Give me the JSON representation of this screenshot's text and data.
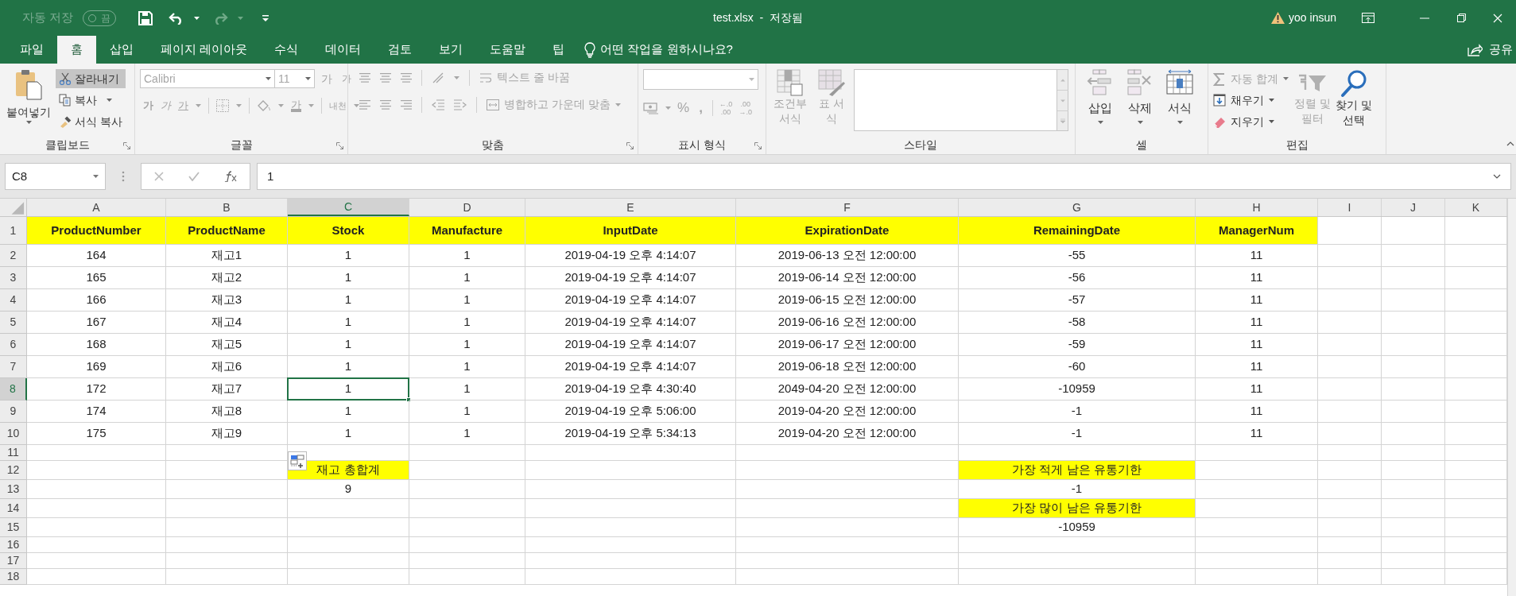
{
  "title_bar": {
    "autosave_label": "자동 저장",
    "autosave_state": "끔",
    "autosave_on": false,
    "title": "test.xlsx  -  저장됨",
    "user": "yoo insun"
  },
  "ribbon_tabs": [
    {
      "label": "파일",
      "selected": false
    },
    {
      "label": "홈",
      "selected": true
    },
    {
      "label": "삽입",
      "selected": false
    },
    {
      "label": "페이지 레이아웃",
      "selected": false
    },
    {
      "label": "수식",
      "selected": false
    },
    {
      "label": "데이터",
      "selected": false
    },
    {
      "label": "검토",
      "selected": false
    },
    {
      "label": "보기",
      "selected": false
    },
    {
      "label": "도움말",
      "selected": false
    },
    {
      "label": "팁",
      "selected": false
    }
  ],
  "tell_me": "어떤 작업을 원하시나요?",
  "share": "공유",
  "ribbon_groups": [
    {
      "kind": "clipboard",
      "label": "클립보드",
      "disabled": false,
      "items": [
        {
          "label": "붙여넣기",
          "highlighted": false
        },
        {
          "label": "잘라내기",
          "highlighted": true
        },
        {
          "label": "복사",
          "highlighted": false
        },
        {
          "label": "서식 복사",
          "highlighted": false
        }
      ]
    },
    {
      "kind": "font",
      "label": "글꼴",
      "disabled": true,
      "font": "Calibri",
      "size": "11",
      "items": [
        {
          "label": "가"
        },
        {
          "label": "가"
        },
        {
          "label": "가"
        },
        {
          "label": "가"
        },
        {
          "label": "가"
        },
        {
          "label": "가"
        },
        {
          "label": "내천"
        }
      ]
    },
    {
      "kind": "alignment",
      "label": "맞춤",
      "disabled": true,
      "items": [
        {
          "label": "텍스트 줄 바꿈"
        },
        {
          "label": "병합하고 가운데 맞춤"
        }
      ]
    },
    {
      "kind": "number",
      "label": "표시 형식",
      "disabled": true,
      "items": [
        {
          "label": "%"
        },
        {
          "label": ","
        },
        {
          "label": "←.0"
        },
        {
          "label": ".00"
        },
        {
          "label": ".00"
        },
        {
          "label": "→.0"
        }
      ]
    },
    {
      "kind": "styles",
      "label": "스타일",
      "disabled": true,
      "items": [
        {
          "label": "조건부 서식"
        },
        {
          "label": "표 서식"
        }
      ]
    },
    {
      "kind": "cells",
      "label": "셀",
      "disabled": false,
      "items": [
        {
          "label": "삽입"
        },
        {
          "label": "삭제"
        },
        {
          "label": "서식"
        }
      ]
    },
    {
      "kind": "editing",
      "label": "편집",
      "disabled": false,
      "items": [
        {
          "label": "자동 합계",
          "disabled": true
        },
        {
          "label": "채우기",
          "disabled": false
        },
        {
          "label": "지우기",
          "disabled": false
        },
        {
          "label": "정렬 및 필터",
          "disabled": true
        },
        {
          "label": "찾기 및 선택",
          "disabled": false
        }
      ]
    }
  ],
  "formula_bar": {
    "name_box": "C8",
    "value": "1"
  },
  "columns": [
    {
      "label": "A",
      "selected": false
    },
    {
      "label": "B",
      "selected": false
    },
    {
      "label": "C",
      "selected": true
    },
    {
      "label": "D",
      "selected": false
    },
    {
      "label": "E",
      "selected": false
    },
    {
      "label": "F",
      "selected": false
    },
    {
      "label": "G",
      "selected": false
    },
    {
      "label": "H",
      "selected": false
    },
    {
      "label": "I",
      "selected": false
    },
    {
      "label": "J",
      "selected": false
    },
    {
      "label": "K",
      "selected": false
    }
  ],
  "rows": [
    {
      "number": "1",
      "selected": false,
      "kind": "header",
      "cells": [
        {
          "text": "ProductNumber",
          "color": "#ffff00"
        },
        {
          "text": "ProductName",
          "color": "#ffff00"
        },
        {
          "text": "Stock",
          "color": "#ffff00"
        },
        {
          "text": "Manufacture",
          "color": "#ffff00"
        },
        {
          "text": "InputDate",
          "color": "#ffff00"
        },
        {
          "text": "ExpirationDate",
          "color": "#ffff00"
        },
        {
          "text": "RemainingDate",
          "color": "#ffff00"
        },
        {
          "text": "ManagerNum",
          "color": "#ffff00"
        }
      ]
    },
    {
      "number": "2",
      "selected": false,
      "kind": "data",
      "cells": [
        {
          "text": "164"
        },
        {
          "text": "재고1"
        },
        {
          "text": "1"
        },
        {
          "text": "1"
        },
        {
          "text": "2019-04-19 오후 4:14:07"
        },
        {
          "text": "2019-06-13 오전 12:00:00"
        },
        {
          "text": "-55"
        },
        {
          "text": "11"
        }
      ]
    },
    {
      "number": "3",
      "selected": false,
      "kind": "data",
      "cells": [
        {
          "text": "165"
        },
        {
          "text": "재고2"
        },
        {
          "text": "1"
        },
        {
          "text": "1"
        },
        {
          "text": "2019-04-19 오후 4:14:07"
        },
        {
          "text": "2019-06-14 오전 12:00:00"
        },
        {
          "text": "-56"
        },
        {
          "text": "11"
        }
      ]
    },
    {
      "number": "4",
      "selected": false,
      "kind": "data",
      "cells": [
        {
          "text": "166"
        },
        {
          "text": "재고3"
        },
        {
          "text": "1"
        },
        {
          "text": "1"
        },
        {
          "text": "2019-04-19 오후 4:14:07"
        },
        {
          "text": "2019-06-15 오전 12:00:00"
        },
        {
          "text": "-57"
        },
        {
          "text": "11"
        }
      ]
    },
    {
      "number": "5",
      "selected": false,
      "kind": "data",
      "cells": [
        {
          "text": "167"
        },
        {
          "text": "재고4"
        },
        {
          "text": "1"
        },
        {
          "text": "1"
        },
        {
          "text": "2019-04-19 오후 4:14:07"
        },
        {
          "text": "2019-06-16 오전 12:00:00"
        },
        {
          "text": "-58"
        },
        {
          "text": "11"
        }
      ]
    },
    {
      "number": "6",
      "selected": false,
      "kind": "data",
      "cells": [
        {
          "text": "168"
        },
        {
          "text": "재고5"
        },
        {
          "text": "1"
        },
        {
          "text": "1"
        },
        {
          "text": "2019-04-19 오후 4:14:07"
        },
        {
          "text": "2019-06-17 오전 12:00:00"
        },
        {
          "text": "-59"
        },
        {
          "text": "11"
        }
      ]
    },
    {
      "number": "7",
      "selected": false,
      "kind": "data",
      "cells": [
        {
          "text": "169"
        },
        {
          "text": "재고6"
        },
        {
          "text": "1"
        },
        {
          "text": "1"
        },
        {
          "text": "2019-04-19 오후 4:14:07"
        },
        {
          "text": "2019-06-18 오전 12:00:00"
        },
        {
          "text": "-60"
        },
        {
          "text": "11"
        }
      ]
    },
    {
      "number": "8",
      "selected": true,
      "kind": "data",
      "cells": [
        {
          "text": "172"
        },
        {
          "text": "재고7"
        },
        {
          "text": "1",
          "active": true
        },
        {
          "text": "1"
        },
        {
          "text": "2019-04-19 오후 4:30:40"
        },
        {
          "text": "2049-04-20 오전 12:00:00"
        },
        {
          "text": "-10959"
        },
        {
          "text": "11"
        }
      ]
    },
    {
      "number": "9",
      "selected": false,
      "kind": "data",
      "cells": [
        {
          "text": "174"
        },
        {
          "text": "재고8"
        },
        {
          "text": "1"
        },
        {
          "text": "1"
        },
        {
          "text": "2019-04-19 오후 5:06:00"
        },
        {
          "text": "2019-04-20 오전 12:00:00"
        },
        {
          "text": "-1"
        },
        {
          "text": "11"
        }
      ]
    },
    {
      "number": "10",
      "selected": false,
      "kind": "data",
      "cells": [
        {
          "text": "175"
        },
        {
          "text": "재고9"
        },
        {
          "text": "1"
        },
        {
          "text": "1"
        },
        {
          "text": "2019-04-19 오후 5:34:13"
        },
        {
          "text": "2019-04-20 오전 12:00:00"
        },
        {
          "text": "-1"
        },
        {
          "text": "11"
        }
      ]
    },
    {
      "number": "11",
      "selected": false
    },
    {
      "number": "12",
      "selected": false
    },
    {
      "number": "13",
      "selected": false
    },
    {
      "number": "14",
      "selected": false
    },
    {
      "number": "15",
      "selected": false
    },
    {
      "number": "16",
      "selected": false
    },
    {
      "number": "17",
      "selected": false
    },
    {
      "number": "18",
      "selected": false
    }
  ],
  "summary_blocks": [
    {
      "label": "재고 총합계",
      "color": "#ffff00",
      "value": "9"
    },
    {
      "label": "가장 적게 남은 유통기한",
      "color": "#ffff00",
      "value": "-1"
    },
    {
      "label": "가장 많이 남은 유통기한",
      "color": "#ffff00",
      "value": "-10959"
    }
  ]
}
